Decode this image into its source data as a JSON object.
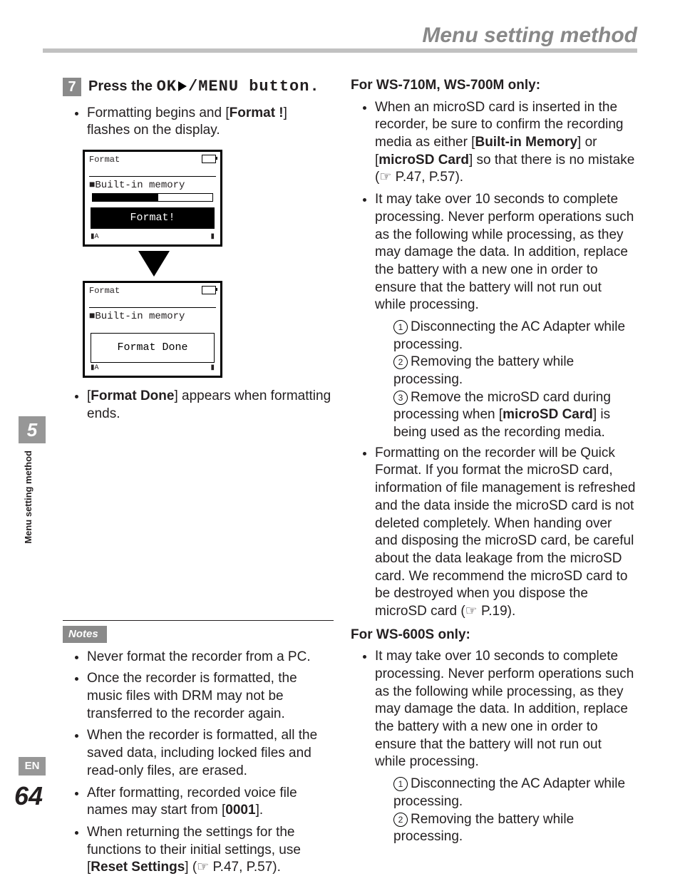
{
  "header": {
    "title": "Menu setting method"
  },
  "left": {
    "step_num": "7",
    "step_prefix": "Press the ",
    "step_ok": "OK",
    "step_suffix": "/MENU button.",
    "bullet1_a": "Formatting begins and [",
    "bullet1_b": "Format !",
    "bullet1_c": "] flashes on the display.",
    "lcd1": {
      "hdr": "Format",
      "mem": "■Built-in memory",
      "msg": "Format!"
    },
    "lcd2": {
      "hdr": "Format",
      "mem": "■Built-in memory",
      "msg": "Format Done"
    },
    "bullet2_a": "[",
    "bullet2_b": "Format Done",
    "bullet2_c": "] appears when formatting ends."
  },
  "notes": {
    "label": "Notes",
    "items": [
      {
        "text": "Never format the recorder from a PC."
      },
      {
        "text": "Once the recorder is formatted, the music files with DRM may not be transferred to the recorder again."
      },
      {
        "text": "When the recorder is formatted, all the saved data, including locked files and read-only files, are erased."
      },
      {
        "pre": "After formatting, recorded voice file names may start from [",
        "bold": "0001",
        "post": "]."
      },
      {
        "pre": "When returning the settings for the functions to their initial settings, use [",
        "bold": "Reset Settings",
        "post": "] (☞ P.47, P.57)."
      }
    ]
  },
  "right": {
    "h1": "For WS-710M, WS-700M only:",
    "r1_a": "When an microSD card is inserted in the recorder, be sure to confirm the recording media as either [",
    "r1_b": "Built-in Memory",
    "r1_c": "] or [",
    "r1_d": "microSD Card",
    "r1_e": "] so that there is no mistake (☞ P.47, P.57).",
    "r2": "It may take over 10 seconds to complete processing. Never perform operations such as the following while processing, as they may damage the data. In addition, replace the battery with a new one in order to ensure that the battery will not run out while processing.",
    "s1": "Disconnecting the AC Adapter while processing.",
    "s2": "Removing the battery while processing.",
    "s3_a": "Remove the microSD card during processing when [",
    "s3_b": "microSD Card",
    "s3_c": "] is being used as the recording media.",
    "r3": "Formatting on the recorder will be Quick Format. If you format the microSD card, information of file management is refreshed and the data inside the microSD card is not deleted completely. When handing over and disposing the microSD card, be careful about the data leakage from the microSD card. We recommend the microSD card to be destroyed when you dispose the microSD card (☞ P.19).",
    "h2": "For WS-600S only:",
    "r4": "It may take over 10 seconds to complete processing. Never perform operations such as the following while processing, as they may damage the data. In addition, replace the battery with a new one in order to ensure that the battery will not run out while processing.",
    "s4": "Disconnecting the AC Adapter while processing.",
    "s5": "Removing the battery while processing."
  },
  "side": {
    "chapter": "5",
    "label": "Menu setting method",
    "lang": "EN",
    "page": "64"
  }
}
